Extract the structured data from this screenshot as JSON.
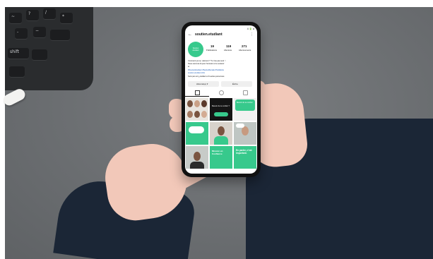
{
  "colors": {
    "desk": "#6e7174",
    "keyboard": "#2a2c2e",
    "sleeve": "#1b2636",
    "skin": "#f2c8b9",
    "phone": "#111111",
    "accent_green": "#37c98c",
    "link_blue": "#1a5bb8"
  },
  "keyboard": {
    "keys": [
      "~",
      "?",
      "/",
      "*",
      "-",
      "−",
      "shift"
    ]
  },
  "phone": {
    "status_time": "",
    "status_right": "4 🔋 a",
    "profile": {
      "back_icon": "back-arrow-icon",
      "username": "soutien.etudiant",
      "menu_icon": "more-icon",
      "avatar_text": "Soutien étudiant",
      "stats": [
        {
          "value": "19",
          "label": "Publications"
        },
        {
          "value": "119",
          "label": "Abonnés"
        },
        {
          "value": "271",
          "label": "Abonnements"
        }
      ],
      "bio_lines": [
        "Comment ça va, vraiment ? Tu n'es pas seul ♡",
        "Nous sommes là pour t'écouter et te soutenir",
        "et",
        "#SoutienEtudiant #SanteMentale #Solidarite",
        "soutien-etudiant.info/",
        "Suivi par ami_etudiant et 6 autres personnes"
      ],
      "buttons": [
        {
          "label": "Abonné(e) ▾"
        },
        {
          "label": "Écrire"
        }
      ],
      "grid_tabs": [
        "grid-icon",
        "reels-icon",
        "tagged-icon"
      ],
      "tile_texts": [
        "Besoin de te confier ?",
        "Besoin de se confier",
        "En parler, c'est important.",
        "Mission en Confiance",
        "En parler, c'est important."
      ]
    }
  }
}
